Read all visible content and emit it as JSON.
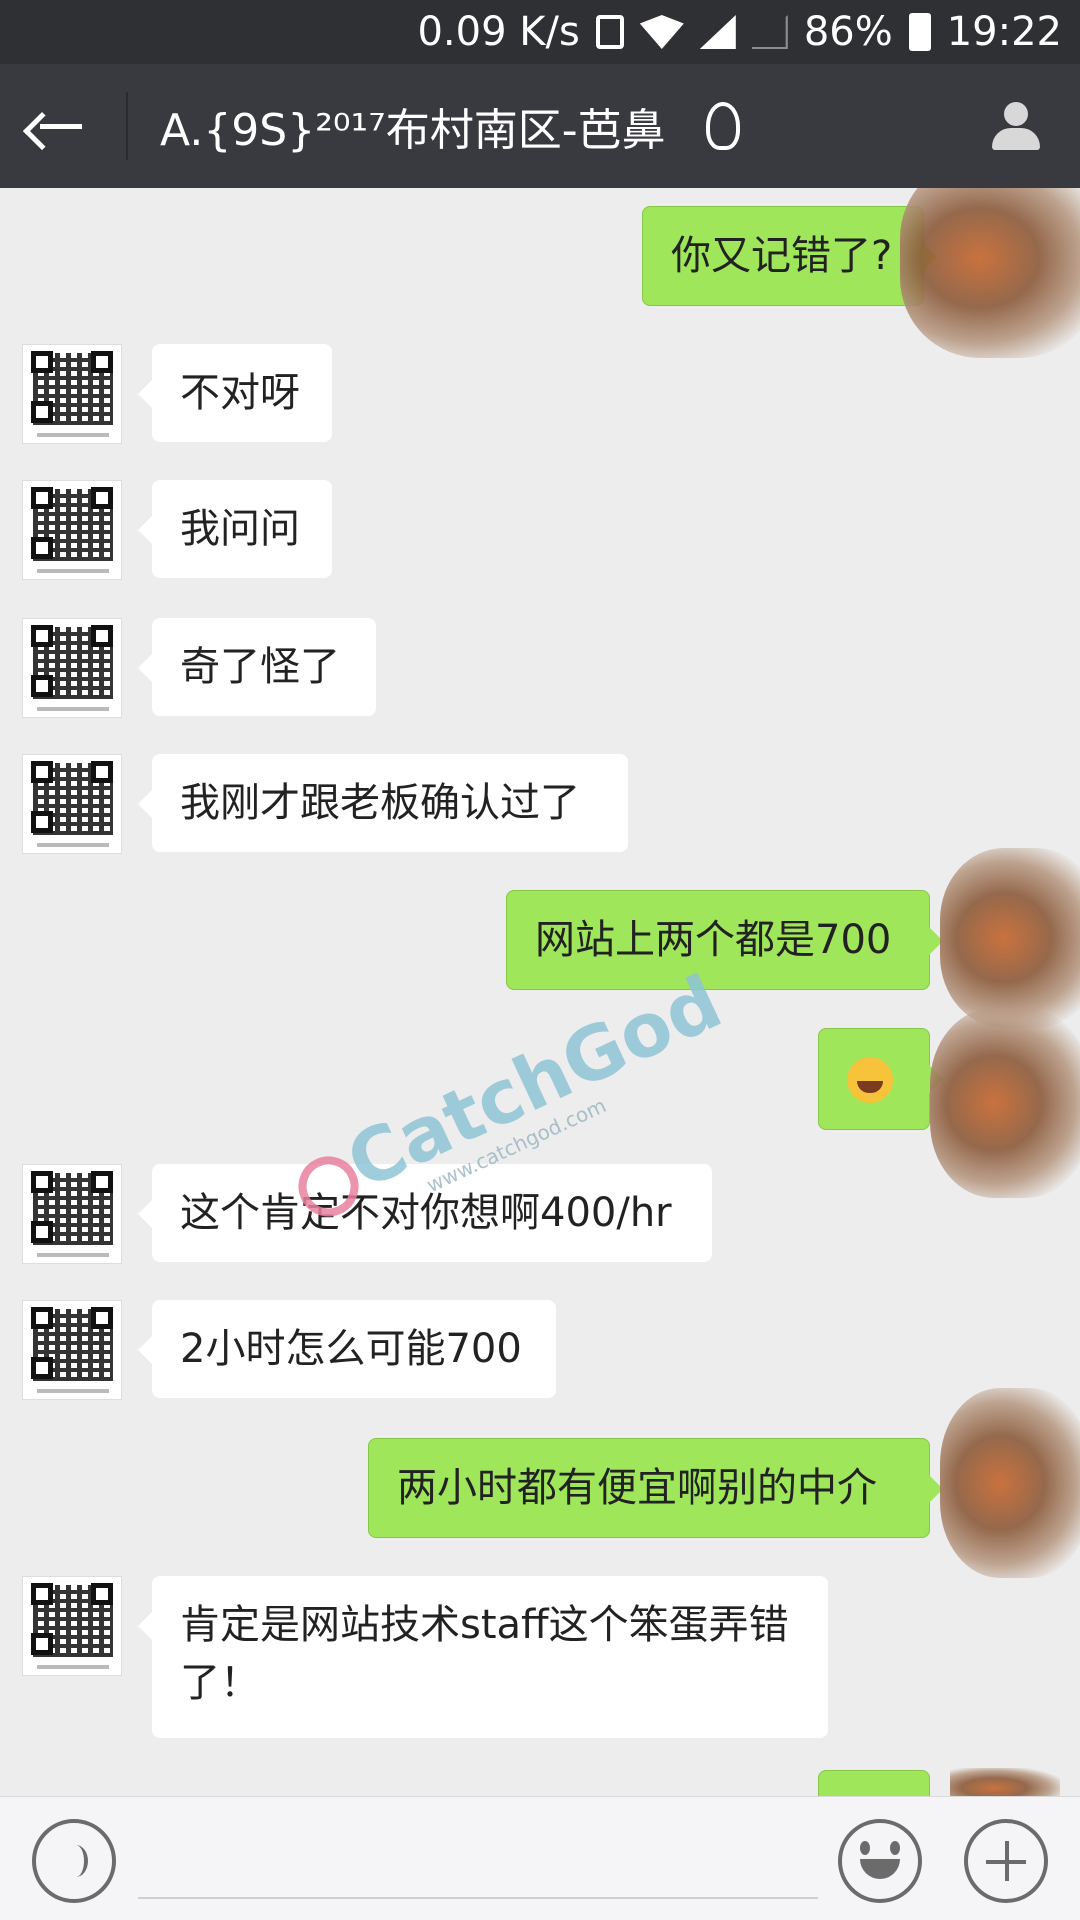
{
  "status": {
    "speed": "0.09 K/s",
    "battery": "86%",
    "time": "19:22"
  },
  "header": {
    "title": "A.{9S}²⁰¹⁷布村南区-芭鼻"
  },
  "messages": [
    {
      "dir": "out",
      "text": "你又记错了?"
    },
    {
      "dir": "in",
      "text": "不对呀"
    },
    {
      "dir": "in",
      "text": "我问问"
    },
    {
      "dir": "in",
      "text": "奇了怪了"
    },
    {
      "dir": "in",
      "text": "我刚才跟老板确认过了"
    },
    {
      "dir": "out",
      "text": "网站上两个都是700"
    },
    {
      "dir": "out",
      "text": "",
      "emoji": "face-with-tears-of-joy-icon"
    },
    {
      "dir": "in",
      "text": "这个肯定不对你想啊400/hr"
    },
    {
      "dir": "in",
      "text": "2小时怎么可能700"
    },
    {
      "dir": "out",
      "text": "两小时都有便宜啊别的中介"
    },
    {
      "dir": "in",
      "text": "肯定是网站技术staff这个笨蛋弄错了！"
    }
  ],
  "watermark": {
    "brand": "CatchGod",
    "url": "www.catchgod.com"
  },
  "colors": {
    "outgoing_bubble": "#9fe65a",
    "incoming_bubble": "#ffffff",
    "titlebar": "#393a3f",
    "statusbar": "#2f3033",
    "background": "#ededed"
  }
}
